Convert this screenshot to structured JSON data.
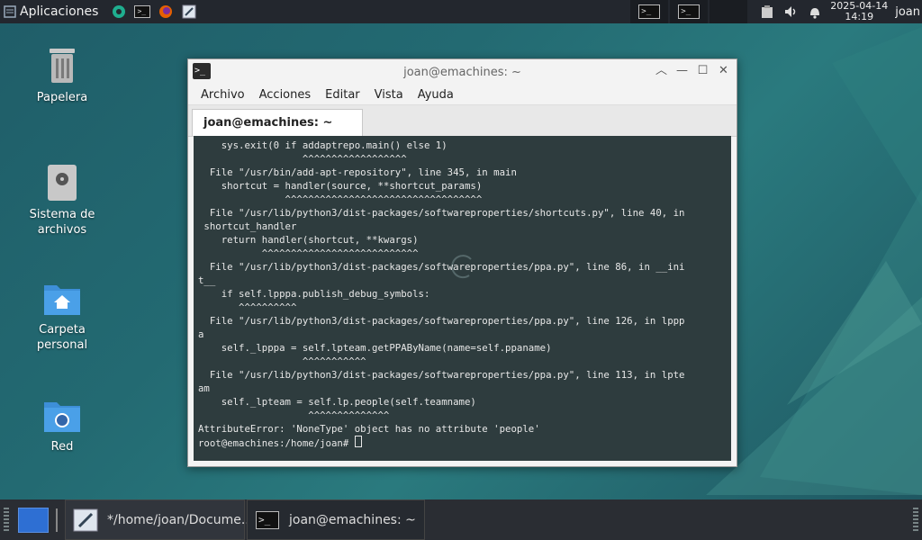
{
  "top_panel": {
    "apps_label": "Aplicaciones",
    "clock_date": "2025-04-14",
    "clock_time": "14:19",
    "user": "joan"
  },
  "desktop": {
    "icons": [
      {
        "label": "Papelera"
      },
      {
        "label": "Sistema de archivos"
      },
      {
        "label": "Carpeta personal"
      },
      {
        "label": "Red"
      }
    ]
  },
  "window": {
    "title": "joan@emachines: ~",
    "menu": [
      "Archivo",
      "Acciones",
      "Editar",
      "Vista",
      "Ayuda"
    ],
    "tab_label": "joan@emachines: ~",
    "terminal_lines": [
      "    sys.exit(0 if addaptrepo.main() else 1)",
      "                  ^^^^^^^^^^^^^^^^^^",
      "  File \"/usr/bin/add-apt-repository\", line 345, in main",
      "    shortcut = handler(source, **shortcut_params)",
      "               ^^^^^^^^^^^^^^^^^^^^^^^^^^^^^^^^^^",
      "  File \"/usr/lib/python3/dist-packages/softwareproperties/shortcuts.py\", line 40, in",
      " shortcut_handler",
      "    return handler(shortcut, **kwargs)",
      "           ^^^^^^^^^^^^^^^^^^^^^^^^^^^",
      "  File \"/usr/lib/python3/dist-packages/softwareproperties/ppa.py\", line 86, in __ini",
      "t__",
      "    if self.lpppa.publish_debug_symbols:",
      "       ^^^^^^^^^^",
      "  File \"/usr/lib/python3/dist-packages/softwareproperties/ppa.py\", line 126, in lppp",
      "a",
      "    self._lpppa = self.lpteam.getPPAByName(name=self.ppaname)",
      "                  ^^^^^^^^^^^",
      "  File \"/usr/lib/python3/dist-packages/softwareproperties/ppa.py\", line 113, in lpte",
      "am",
      "    self._lpteam = self.lp.people(self.teamname)",
      "                   ^^^^^^^^^^^^^^",
      "AttributeError: 'NoneType' object has no attribute 'people'"
    ],
    "prompt": "root@emachines:/home/joan# "
  },
  "taskbar": {
    "tasks": [
      {
        "label": "*/home/joan/Docume..."
      },
      {
        "label": "joan@emachines: ~"
      }
    ]
  },
  "colors": {
    "terminal_bg": "#2e3c3e",
    "panel_bg": "#23272e",
    "accent": "#2e6fd3"
  }
}
